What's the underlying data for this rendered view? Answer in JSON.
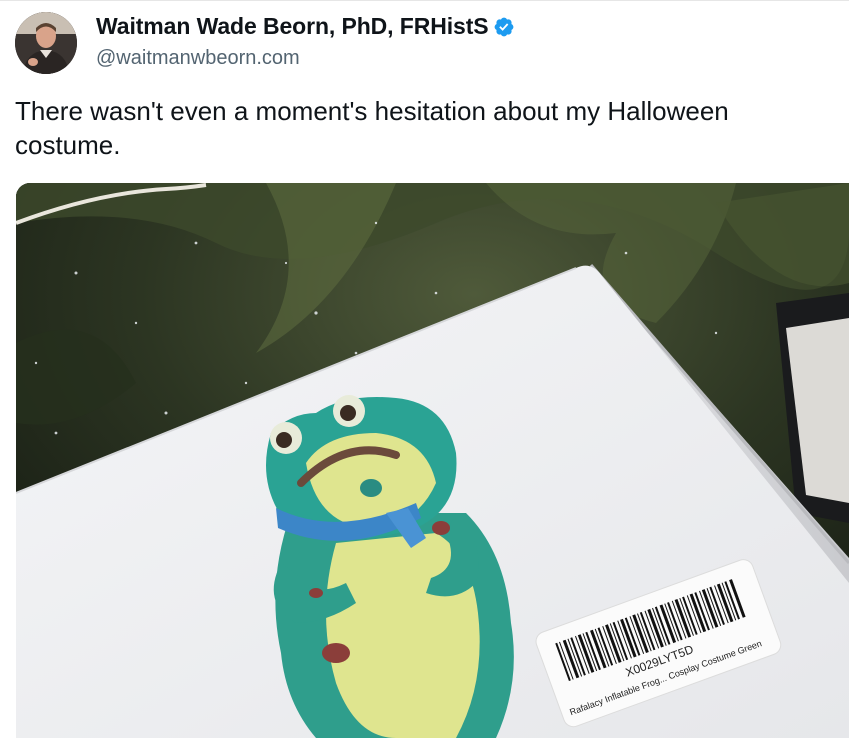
{
  "tweet": {
    "author": {
      "display_name": "Waitman Wade Beorn, PhD, FRHistS",
      "handle": "@waitmanwbeorn.com",
      "verified": true,
      "verified_color": "#1d9bf0"
    },
    "text": "There wasn't even a moment's hesitation about my Halloween costume.",
    "media": {
      "label_barcode": "X0029LYT5D",
      "label_product": "Rafalacy Inflatable Frog... Cosplay Costume Green"
    }
  },
  "icons": {
    "verified": "verified-badge-icon"
  },
  "colors": {
    "text_primary": "#0f1419",
    "text_secondary": "#536471",
    "accent": "#1d9bf0"
  }
}
